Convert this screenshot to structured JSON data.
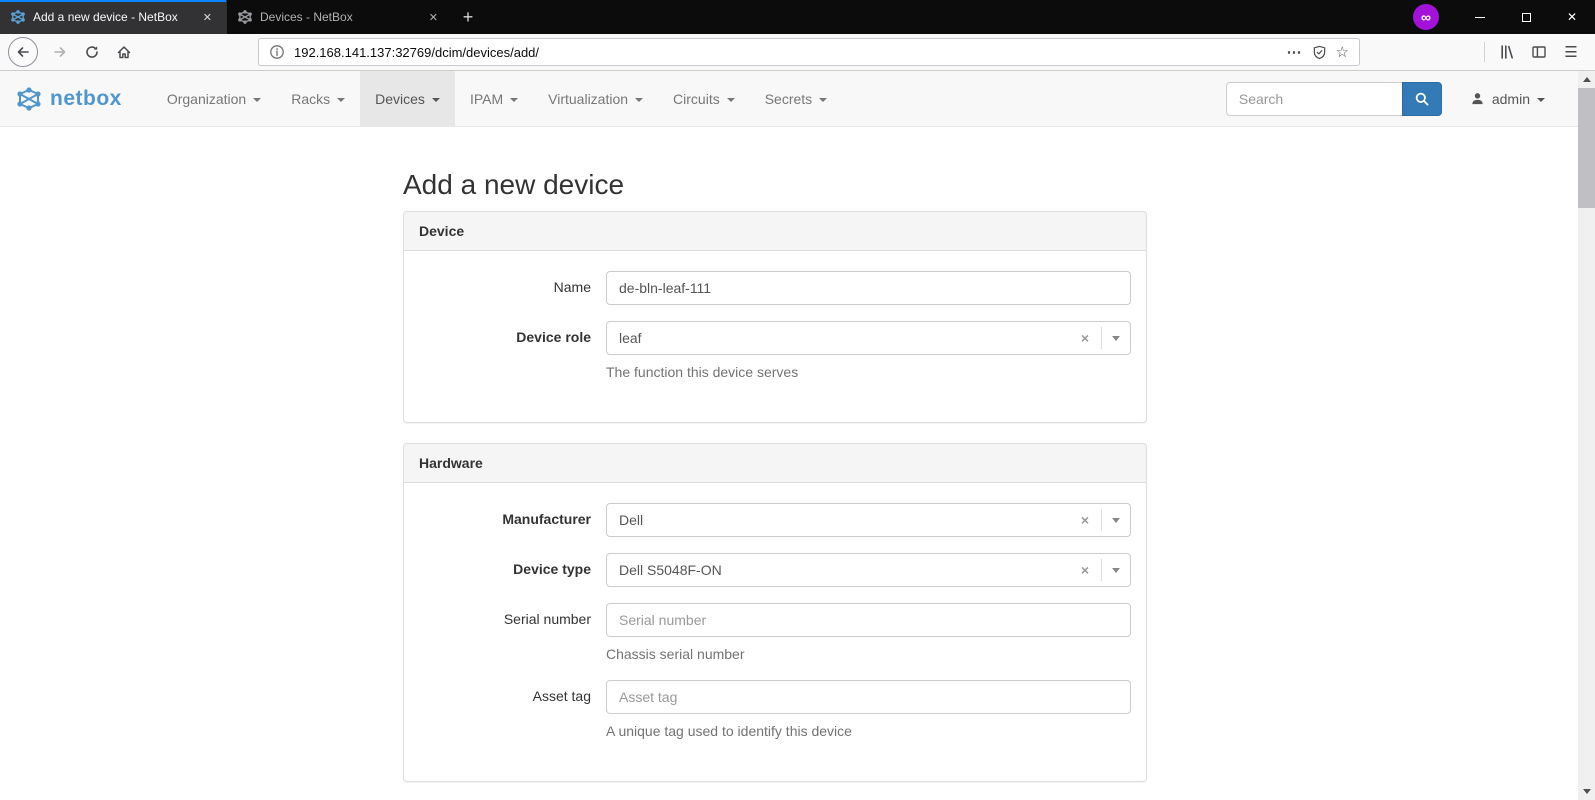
{
  "colors": {
    "active_tab_accent": "#0a84ff",
    "netbox_logo_blue": "#5196cc",
    "primary_blue": "#337ab7",
    "extension_badge": "#a312d9",
    "navbar_bg": "#f8f8f8",
    "panel_heading_bg": "#f5f5f5"
  },
  "icons": {
    "close": "✕",
    "plus": "+",
    "dots": "⋯",
    "menu": "☰",
    "star": "☆",
    "infinity": "∞",
    "clear": "×",
    "minimize": "—"
  },
  "browser": {
    "tabs": [
      {
        "title": "Add a new device - NetBox"
      },
      {
        "title": "Devices - NetBox"
      }
    ],
    "url": "192.168.141.137:32769/dcim/devices/add/"
  },
  "navbar": {
    "brand": "netbox",
    "items": [
      "Organization",
      "Racks",
      "Devices",
      "IPAM",
      "Virtualization",
      "Circuits",
      "Secrets"
    ],
    "active_item": "Devices",
    "search_placeholder": "Search",
    "username": "admin"
  },
  "page": {
    "title": "Add a new device",
    "panels": [
      {
        "title": "Device",
        "fields": [
          {
            "label": "Name",
            "control": "input",
            "value": "de-bln-leaf-111",
            "placeholder": "",
            "required": false,
            "help": ""
          },
          {
            "label": "Device role",
            "control": "select",
            "value": "leaf",
            "required": true,
            "help": "The function this device serves"
          }
        ]
      },
      {
        "title": "Hardware",
        "fields": [
          {
            "label": "Manufacturer",
            "control": "select",
            "value": "Dell",
            "required": true,
            "help": ""
          },
          {
            "label": "Device type",
            "control": "select",
            "value": "Dell S5048F-ON",
            "required": true,
            "help": ""
          },
          {
            "label": "Serial number",
            "control": "input",
            "value": "",
            "placeholder": "Serial number",
            "required": false,
            "help": "Chassis serial number"
          },
          {
            "label": "Asset tag",
            "control": "input",
            "value": "",
            "placeholder": "Asset tag",
            "required": false,
            "help": "A unique tag used to identify this device"
          }
        ]
      }
    ]
  }
}
